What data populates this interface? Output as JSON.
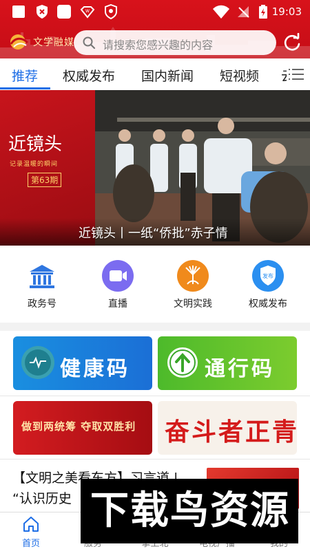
{
  "status_bar": {
    "time": "19:03",
    "icons": [
      "square-icon",
      "shield-x-icon",
      "square-icon",
      "app-badge-icon",
      "shield-app-icon",
      "wifi-icon",
      "no-signal-icon",
      "battery-charging-icon"
    ]
  },
  "header": {
    "logo_text": "文学融媒",
    "search_placeholder": "请搜索您感兴趣的内容",
    "refresh_icon": "refresh-icon",
    "brand_color": "#d8121b"
  },
  "tabs": {
    "items": [
      {
        "label": "推荐",
        "active": true
      },
      {
        "label": "权威发布",
        "active": false
      },
      {
        "label": "国内新闻",
        "active": false
      },
      {
        "label": "短视频",
        "active": false
      },
      {
        "label": "云",
        "active": false
      }
    ],
    "menu_icon": "menu-icon",
    "accent_color": "#1e6ee6"
  },
  "banner": {
    "brand": "近镜头",
    "brand_sub": "记录温暖的瞬间",
    "issue": "第63期",
    "caption": "近镜头丨一纸“侨批”赤子情"
  },
  "quick_links": [
    {
      "label": "政务号",
      "icon": "government-building-icon"
    },
    {
      "label": "直播",
      "icon": "live-video-icon"
    },
    {
      "label": "文明实践",
      "icon": "civilization-practice-icon"
    },
    {
      "label": "权威发布",
      "icon": "official-release-shield-icon",
      "badge": "发布"
    }
  ],
  "service_cards": [
    {
      "label": "健康码",
      "icon": "health-code-icon",
      "color": "#1a8fe0"
    },
    {
      "label": "通行码",
      "icon": "pass-code-arrow-icon",
      "color": "#4dba2b"
    },
    {
      "label": "做到两统筹 夺取双胜利",
      "icon": "",
      "color": "#c8141c"
    },
    {
      "label": "奋斗者正青春",
      "icon": "",
      "color": "#d41b1b"
    }
  ],
  "news": {
    "title": "【文明之美看东方】习言道 | “认识历史"
  },
  "bottom_nav": [
    {
      "label": "首页",
      "icon": "home-icon",
      "active": true
    },
    {
      "label": "服务",
      "icon": "service-icon",
      "active": false
    },
    {
      "label": "掌上北",
      "icon": "palm-icon",
      "active": false
    },
    {
      "label": "电视广播",
      "icon": "tv-icon",
      "active": false
    },
    {
      "label": "我的",
      "icon": "user-icon",
      "active": false
    }
  ],
  "watermark": {
    "text": "下载鸟资源"
  }
}
